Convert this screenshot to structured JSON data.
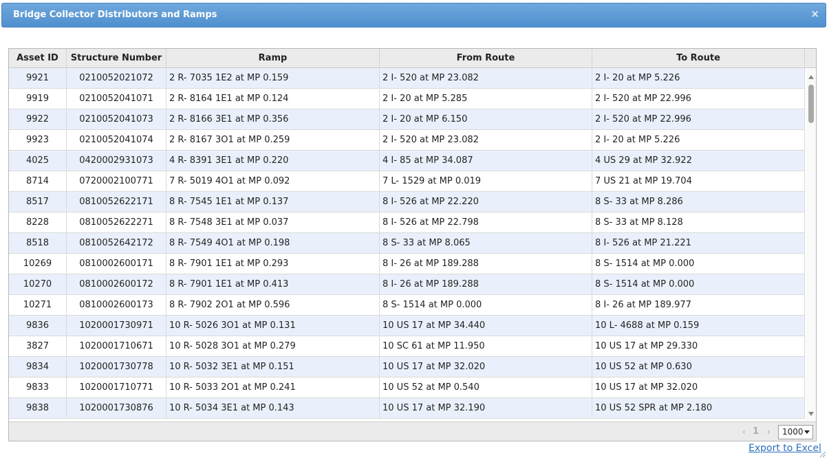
{
  "dialog": {
    "title": "Bridge Collector Distributors and Ramps",
    "close_glyph": "×"
  },
  "grid": {
    "columns": [
      "Asset ID",
      "Structure Number",
      "Ramp",
      "From Route",
      "To Route"
    ],
    "rows": [
      [
        "9921",
        "0210052021072",
        "2 R- 7035 1E2 at MP 0.159",
        "2 I- 520 at MP 23.082",
        "2 I- 20 at MP 5.226"
      ],
      [
        "9919",
        "0210052041071",
        "2 R- 8164 1E1 at MP 0.124",
        "2 I- 20 at MP 5.285",
        "2 I- 520 at MP 22.996"
      ],
      [
        "9922",
        "0210052041073",
        "2 R- 8166 3E1 at MP 0.356",
        "2 I- 20 at MP 6.150",
        "2 I- 520 at MP 22.996"
      ],
      [
        "9923",
        "0210052041074",
        "2 R- 8167 3O1 at MP 0.259",
        "2 I- 520 at MP 23.082",
        "2 I- 20 at MP 5.226"
      ],
      [
        "4025",
        "0420002931073",
        "4 R- 8391 3E1 at MP 0.220",
        "4 I- 85 at MP 34.087",
        "4 US 29 at MP 32.922"
      ],
      [
        "8714",
        "0720002100771",
        "7 R- 5019 4O1 at MP 0.092",
        "7 L- 1529 at MP 0.019",
        "7 US 21 at MP 19.704"
      ],
      [
        "8517",
        "0810052622171",
        "8 R- 7545 1E1 at MP 0.137",
        "8 I- 526 at MP 22.220",
        "8 S- 33 at MP 8.286"
      ],
      [
        "8228",
        "0810052622271",
        "8 R- 7548 3E1 at MP 0.037",
        "8 I- 526 at MP 22.798",
        "8 S- 33 at MP 8.128"
      ],
      [
        "8518",
        "0810052642172",
        "8 R- 7549 4O1 at MP 0.198",
        "8 S- 33 at MP 8.065",
        "8 I- 526 at MP 21.221"
      ],
      [
        "10269",
        "0810002600171",
        "8 R- 7901 1E1 at MP 0.293",
        "8 I- 26 at MP 189.288",
        "8 S- 1514 at MP 0.000"
      ],
      [
        "10270",
        "0810002600172",
        "8 R- 7901 1E1 at MP 0.413",
        "8 I- 26 at MP 189.288",
        "8 S- 1514 at MP 0.000"
      ],
      [
        "10271",
        "0810002600173",
        "8 R- 7902 2O1 at MP 0.596",
        "8 S- 1514 at MP 0.000",
        "8 I- 26 at MP 189.977"
      ],
      [
        "9836",
        "1020001730971",
        "10 R- 5026 3O1 at MP 0.131",
        "10 US 17 at MP 34.440",
        "10 L- 4688 at MP 0.159"
      ],
      [
        "3827",
        "1020001710671",
        "10 R- 5028 3O1 at MP 0.279",
        "10 SC 61 at MP 11.950",
        "10 US 17 at MP 29.330"
      ],
      [
        "9834",
        "1020001730778",
        "10 R- 5032 3E1 at MP 0.151",
        "10 US 17 at MP 32.020",
        "10 US 52 at MP 0.630"
      ],
      [
        "9833",
        "1020001710771",
        "10 R- 5033 2O1 at MP 0.241",
        "10 US 52 at MP 0.540",
        "10 US 17 at MP 32.020"
      ],
      [
        "9838",
        "1020001730876",
        "10 R- 5034 3E1 at MP 0.143",
        "10 US 17 at MP 32.190",
        "10 US 52 SPR at MP 2.180"
      ]
    ]
  },
  "pager": {
    "prev_glyph": "‹",
    "page": "1",
    "next_glyph": "›",
    "page_size": "1000"
  },
  "export_label": "Export to Excel",
  "icons": {
    "close": "close-icon",
    "scroll_up": "arrow-up-icon",
    "scroll_down": "arrow-down-icon",
    "resize": "resize-grip-icon"
  }
}
